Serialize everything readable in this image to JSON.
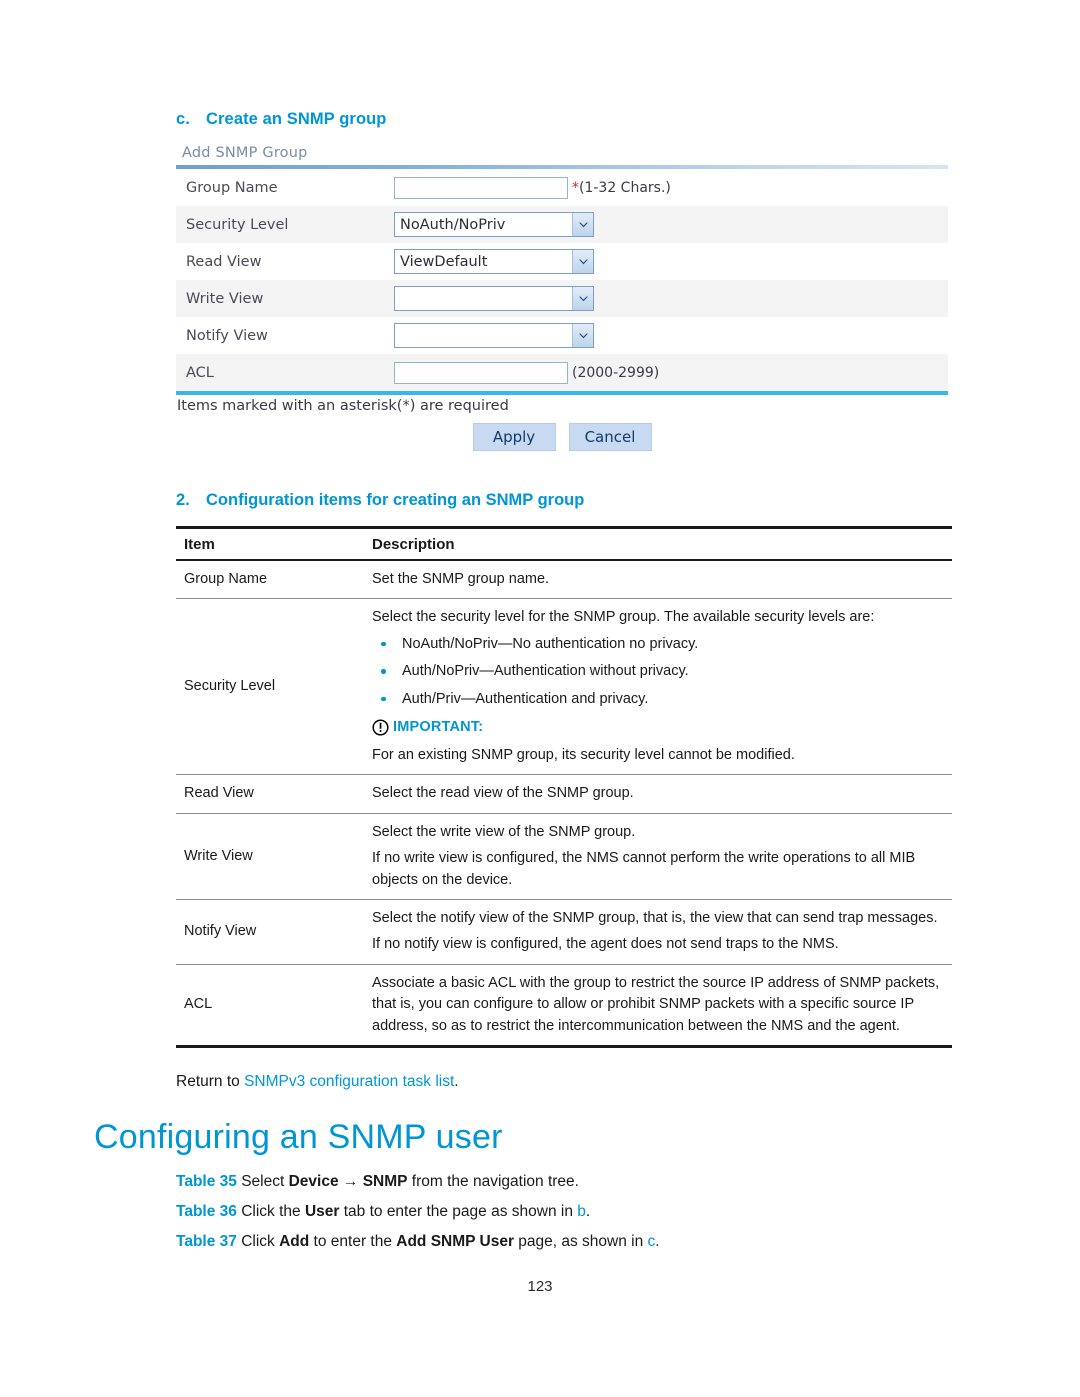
{
  "document": {
    "page_number": "123"
  },
  "step_c": {
    "marker": "c.",
    "title": "Create an SNMP group"
  },
  "webui": {
    "panel_title": "Add SNMP Group",
    "fields": [
      {
        "label": "Group Name",
        "control": "text",
        "value": "",
        "hint": "(1-32 Chars.)",
        "required_mark": "*"
      },
      {
        "label": "Security Level",
        "control": "select",
        "value": "NoAuth/NoPriv",
        "hint": "",
        "required_mark": ""
      },
      {
        "label": "Read View",
        "control": "select",
        "value": "ViewDefault",
        "hint": "",
        "required_mark": ""
      },
      {
        "label": "Write View",
        "control": "select",
        "value": "",
        "hint": "",
        "required_mark": ""
      },
      {
        "label": "Notify View",
        "control": "select",
        "value": "",
        "hint": "",
        "required_mark": ""
      },
      {
        "label": "ACL",
        "control": "text",
        "value": "",
        "hint": "(2000-2999)",
        "required_mark": ""
      }
    ],
    "asterisk_note": "Items marked with an asterisk(*) are required",
    "apply_label": "Apply",
    "cancel_label": "Cancel"
  },
  "table_caption": {
    "marker": "2.",
    "title": "Configuration items for creating an SNMP group"
  },
  "config_table": {
    "headers": {
      "item": "Item",
      "description": "Description"
    },
    "rows": {
      "group_name": {
        "item": "Group Name",
        "line1": "Set the SNMP group name."
      },
      "security_level": {
        "item": "Security Level",
        "intro": "Select the security level for the SNMP group. The available security levels are:",
        "bullets": [
          "NoAuth/NoPriv—No authentication no privacy.",
          "Auth/NoPriv—Authentication without privacy.",
          "Auth/Priv—Authentication and privacy."
        ],
        "important_label": "IMPORTANT:",
        "important_text": "For an existing SNMP group, its security level cannot be modified."
      },
      "read_view": {
        "item": "Read View",
        "line1": "Select the read view of the SNMP group."
      },
      "write_view": {
        "item": "Write View",
        "line1": "Select the write view of the SNMP group.",
        "line2": "If no write view is configured, the NMS cannot perform the write operations to all MIB objects on the device."
      },
      "notify_view": {
        "item": "Notify View",
        "line1": "Select the notify view of the SNMP group, that is, the view that can send trap messages.",
        "line2": "If no notify view is configured, the agent does not send traps to the NMS."
      },
      "acl": {
        "item": "ACL",
        "line1": "Associate a basic ACL with the group to restrict the source IP address of SNMP packets, that is, you can configure to allow or prohibit SNMP packets with a specific source IP address, so as to restrict the intercommunication between the NMS and the agent."
      }
    }
  },
  "return_line": {
    "prefix": "Return to ",
    "link": "SNMPv3 configuration task list",
    "suffix": "."
  },
  "section_heading": "Configuring an SNMP user",
  "steps": [
    {
      "num": "Table 35",
      "p1": " Select ",
      "b1": "Device",
      "arrow": " → ",
      "b2": "SNMP",
      "p2": " from the navigation tree.",
      "b3": "",
      "p3": "",
      "ref": "",
      "tail": ""
    },
    {
      "num": "Table 36",
      "p1": " Click the ",
      "b1": "User",
      "arrow": "",
      "b2": "",
      "p2": " tab to enter the page as shown in ",
      "b3": "",
      "p3": "",
      "ref": "b",
      "tail": "."
    },
    {
      "num": "Table 37",
      "p1": " Click ",
      "b1": "Add",
      "arrow": "",
      "b2": "",
      "p2": " to enter the ",
      "b3": "Add SNMP User",
      "p3": " page, as shown in ",
      "ref": "c",
      "tail": "."
    }
  ],
  "colors": {
    "accent_blue": "#0096d6",
    "panel_title": "#7d8ba6",
    "table_rule": "#1a1a1a",
    "form_bottom_bar": "#3cb4f0",
    "button_fill": "#c8daf2",
    "required_star": "#d8232a"
  }
}
